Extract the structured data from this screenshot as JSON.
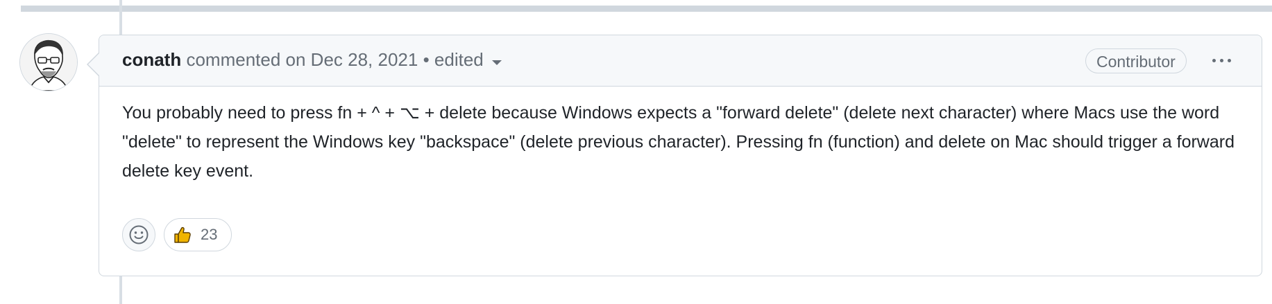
{
  "comment": {
    "author": "conath",
    "action": "commented on Dec 28, 2021",
    "separator": "•",
    "edited_label": "edited",
    "role_badge": "Contributor",
    "body": "You probably need to press fn + ^ + ⌥ + delete because Windows expects a \"forward delete\" (delete next character) where Macs use the word \"delete\" to represent the Windows key \"backspace\" (delete previous character). Pressing fn (function) and delete on Mac should trigger a forward delete key event.",
    "reactions": [
      {
        "emoji": "thumbs-up-icon",
        "count": "23"
      }
    ],
    "more_menu_icon": "kebab-horizontal-icon",
    "add_reaction_icon": "smiley-icon"
  },
  "colors": {
    "border": "#d0d7de",
    "header_bg": "#f6f8fa",
    "muted_text": "#656d76",
    "text": "#1f2328",
    "thumb_yellow": "#f0b400"
  }
}
